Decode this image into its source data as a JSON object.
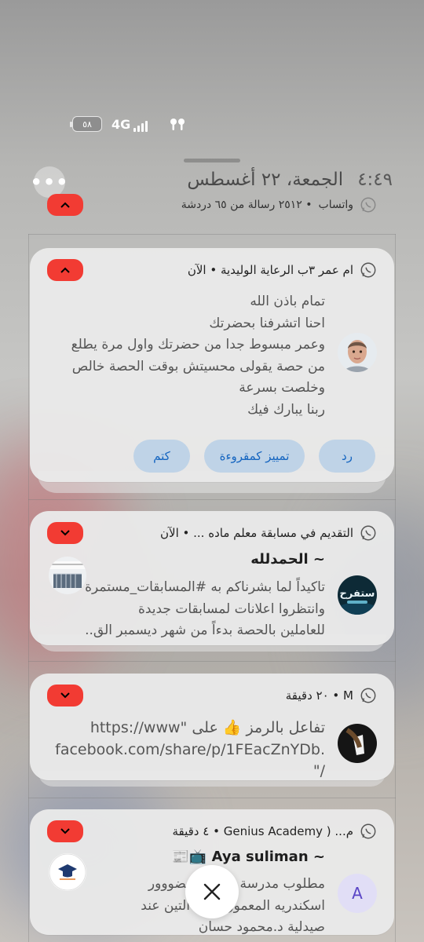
{
  "status": {
    "battery": "٥٨",
    "network": "4G"
  },
  "header": {
    "time": "٤:٤٩",
    "date": "الجمعة، ٢٢ أغسطس",
    "app": "واتساب",
    "summary": "• ٢٥١٢ رسالة من ٦٥ دردشة"
  },
  "notifications": [
    {
      "header": "ام عمر ٣ب الرعاية الوليدية • الآن",
      "lines": [
        "تمام باذن الله",
        "احنا اتشرفنا بحضرتك",
        "وعمر مبسوط جدا من حضرتك واول مرة يطلع",
        "من حصة يقولى محسيتش بوقت الحصة خالص",
        "وخلصت بسرعة",
        "ربنا يبارك فيك"
      ],
      "actions": [
        "رد",
        "تمييز كمقروءة",
        "كتم"
      ]
    },
    {
      "header": "التقديم في مسابقة معلم ماده ...  • الآن",
      "title": "~ الحمدلله",
      "lines": [
        "تاكيداً لما بشرناكم به #المسابقات_مستمرة",
        "وانتظروا اعلانات لمسابقات جديدة",
        "للعاملين بالحصة بدءاً من شهر ديسمبر الق.."
      ]
    },
    {
      "header": "M • ٢٠ دقيقة",
      "lines": [
        "تفاعل بالرمز 👍 على \"https://www",
        ".facebook.com/share/p/1FEacZnYDb",
        "/\""
      ]
    },
    {
      "header": "م... ( Genius Academy • ٤ دقيقة",
      "title": "~ Aya suliman 📺📰",
      "avatar_letter": "A",
      "lines": [
        "مطلوب مدرسة ابتدائي حضووور",
        "اسكندريه المعمورة فرع التين  عند",
        "صيدلية د.محمود حسان"
      ]
    }
  ],
  "colors": {
    "accent_red": "#f23b33",
    "action_bg": "#bfd3e7",
    "action_text": "#1565c0"
  }
}
